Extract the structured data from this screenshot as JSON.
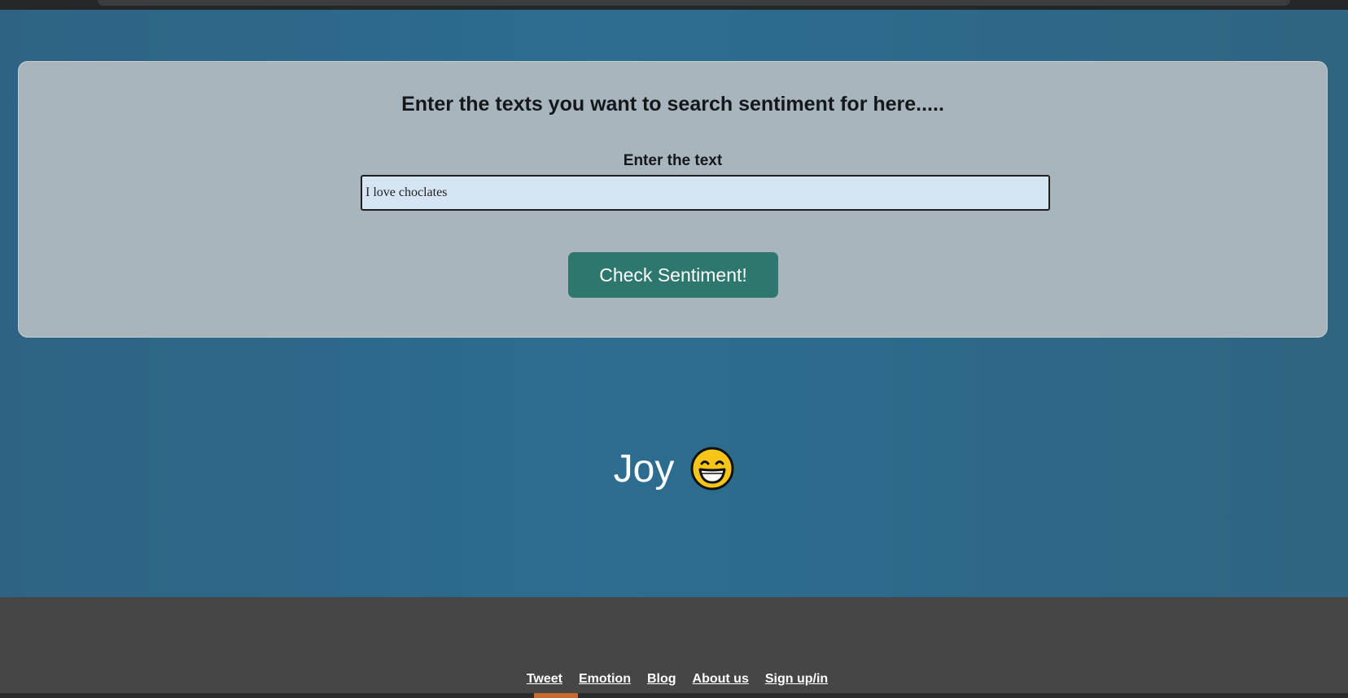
{
  "form": {
    "heading": "Enter the texts you want to search sentiment for here.....",
    "label": "Enter the text",
    "input_value": "I love choclates",
    "button_label": "Check Sentiment!"
  },
  "result": {
    "emotion": "Joy",
    "emoji_icon": "grinning-face-icon"
  },
  "footer": {
    "links": [
      "Tweet",
      "Emotion",
      "Blog",
      "About us",
      "Sign up/in"
    ]
  },
  "colors": {
    "background": "#2c6d90",
    "card": "#a9b5bc",
    "button": "#2d776f",
    "input": "#d6e5f4",
    "footer": "#464646"
  }
}
